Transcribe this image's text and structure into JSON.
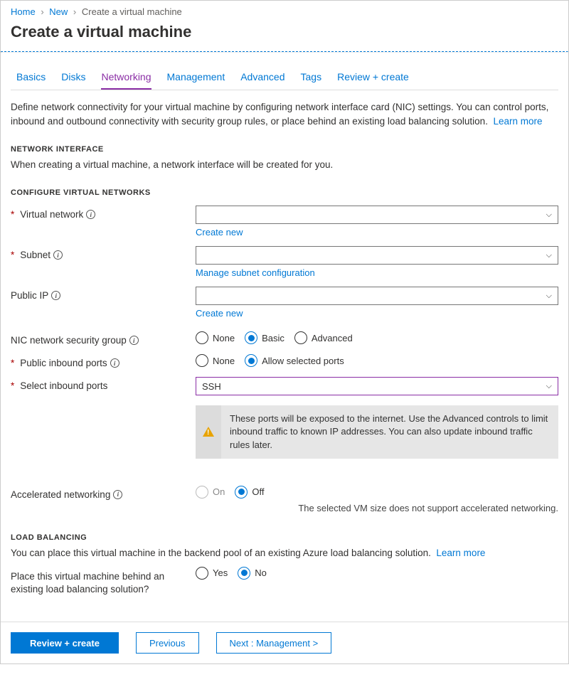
{
  "breadcrumb": {
    "home": "Home",
    "new": "New",
    "current": "Create a virtual machine"
  },
  "title": "Create a virtual machine",
  "tabs": [
    "Basics",
    "Disks",
    "Networking",
    "Management",
    "Advanced",
    "Tags",
    "Review + create"
  ],
  "active_tab": "Networking",
  "intro": "Define network connectivity for your virtual machine by configuring network interface card (NIC) settings. You can control ports, inbound and outbound connectivity with security group rules, or place behind an existing load balancing solution.",
  "learn_more": "Learn more",
  "network_interface": {
    "heading": "NETWORK INTERFACE",
    "sub": "When creating a virtual machine, a network interface will be created for you."
  },
  "configure": {
    "heading": "CONFIGURE VIRTUAL NETWORKS",
    "virtual_network_label": "Virtual network",
    "virtual_network_create": "Create new",
    "subnet_label": "Subnet",
    "subnet_manage": "Manage subnet configuration",
    "public_ip_label": "Public IP",
    "public_ip_create": "Create new",
    "nic_nsg_label": "NIC network security group",
    "nic_opts": {
      "none": "None",
      "basic": "Basic",
      "advanced": "Advanced"
    },
    "inbound_ports_label": "Public inbound ports",
    "inbound_opts": {
      "none": "None",
      "allow": "Allow selected ports"
    },
    "select_ports_label": "Select inbound ports",
    "select_ports_value": "SSH",
    "ports_warning": "These ports will be exposed to the internet. Use the Advanced controls to limit inbound traffic to known IP addresses. You can also update inbound traffic rules later.",
    "accel_label": "Accelerated networking",
    "accel_opts": {
      "on": "On",
      "off": "Off"
    },
    "accel_hint": "The selected VM size does not support accelerated networking."
  },
  "lb": {
    "heading": "LOAD BALANCING",
    "sub": "You can place this virtual machine in the backend pool of an existing Azure load balancing solution.",
    "learn_more": "Learn more",
    "q": "Place this virtual machine behind an existing load balancing solution?",
    "opts": {
      "yes": "Yes",
      "no": "No"
    }
  },
  "footer": {
    "review": "Review + create",
    "prev": "Previous",
    "next": "Next : Management >"
  }
}
